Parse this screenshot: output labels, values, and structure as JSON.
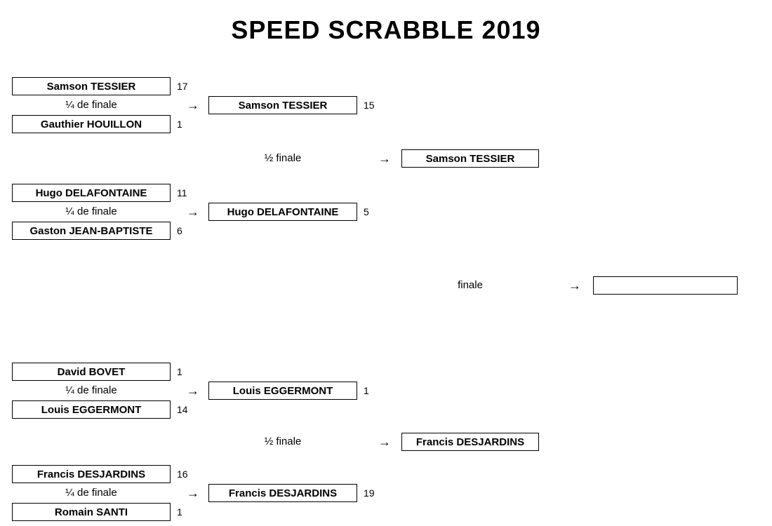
{
  "title": "SPEED SCRABBLE 2019",
  "labels": {
    "quarter": "¼ de finale",
    "semi": "½ finale",
    "final": "finale"
  },
  "arrow": "→",
  "bracket": {
    "qf": [
      {
        "p1": "Samson TESSIER",
        "s1": "17",
        "p2": "Gauthier HOUILLON",
        "s2": "1"
      },
      {
        "p1": "Hugo DELAFONTAINE",
        "s1": "11",
        "p2": "Gaston JEAN-BAPTISTE",
        "s2": "6"
      },
      {
        "p1": "David BOVET",
        "s1": "1",
        "p2": "Louis EGGERMONT",
        "s2": "14"
      },
      {
        "p1": "Francis DESJARDINS",
        "s1": "16",
        "p2": "Romain SANTI",
        "s2": "1"
      }
    ],
    "sf": [
      {
        "p": "Samson TESSIER",
        "s": "15"
      },
      {
        "p": "Hugo DELAFONTAINE",
        "s": "5"
      },
      {
        "p": "Louis EGGERMONT",
        "s": "1"
      },
      {
        "p": "Francis DESJARDINS",
        "s": "19"
      }
    ],
    "f": [
      {
        "p": "Samson TESSIER"
      },
      {
        "p": "Francis DESJARDINS"
      }
    ],
    "winner": ""
  }
}
